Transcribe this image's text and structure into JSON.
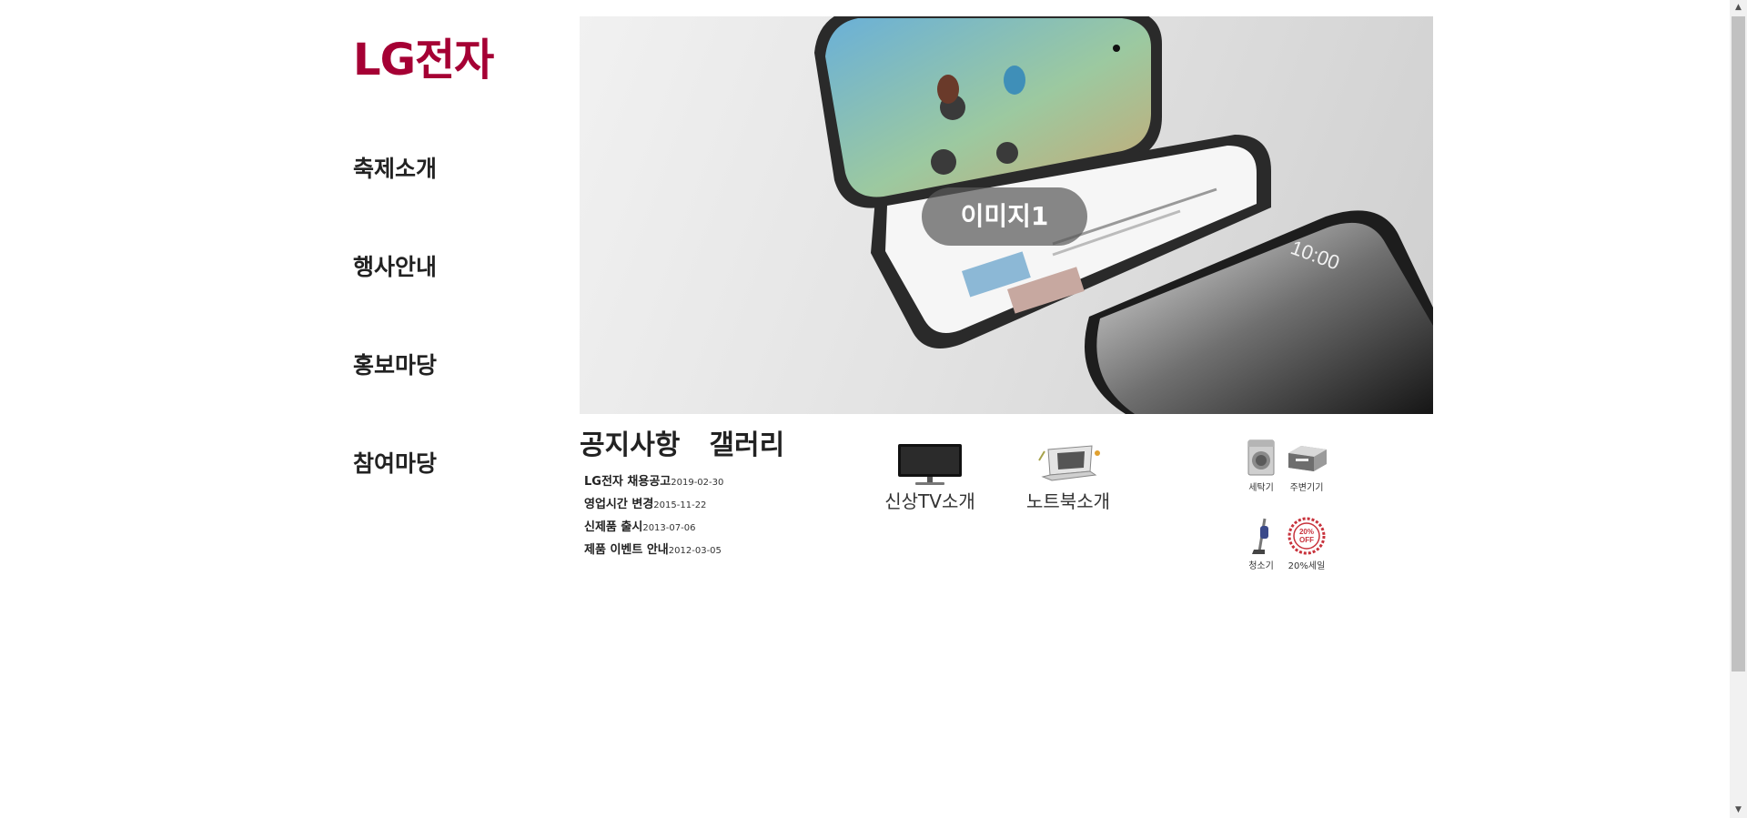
{
  "logo": {
    "text": "LG전자",
    "color": "#a50034"
  },
  "nav": {
    "items": [
      {
        "label": "축제소개"
      },
      {
        "label": "행사안내"
      },
      {
        "label": "홍보마당"
      },
      {
        "label": "참여마당"
      }
    ]
  },
  "hero": {
    "label": "이미지1"
  },
  "tabs": [
    {
      "label": "공지사항"
    },
    {
      "label": "갤러리"
    }
  ],
  "notices": [
    {
      "title": "LG전자 채용공고",
      "date": "2019-02-30"
    },
    {
      "title": "영업시간 변경",
      "date": "2015-11-22"
    },
    {
      "title": "신제품 출시",
      "date": "2013-07-06"
    },
    {
      "title": "제품 이벤트 안내",
      "date": "2012-03-05"
    }
  ],
  "products": [
    {
      "label": "신상TV소개",
      "icon": "monitor-icon"
    },
    {
      "label": "노트북소개",
      "icon": "laptop-icon"
    }
  ],
  "mini_items": [
    {
      "label": "세탁기",
      "icon": "washer-icon"
    },
    {
      "label": "주변기기",
      "icon": "printer-icon"
    },
    {
      "label": "청소기",
      "icon": "vacuum-icon"
    },
    {
      "label": "20%세일",
      "icon": "sale-stamp-icon",
      "stamp_text": "20% OFF"
    }
  ]
}
